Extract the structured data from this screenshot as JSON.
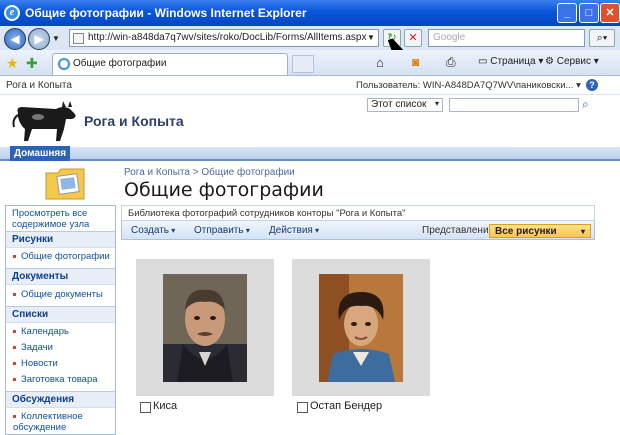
{
  "window": {
    "title": "Общие фотографии - Windows Internet Explorer",
    "minimize_glyph": "_",
    "maximize_glyph": "□",
    "close_glyph": "✕"
  },
  "addressbar": {
    "url": "http://win-a848da7q7wv/sites/roko/DocLib/Forms/AllItems.aspx",
    "search_placeholder": "Google",
    "back_glyph": "◀",
    "forward_glyph": "▶"
  },
  "browser_tab": {
    "label": "Общие фотографии"
  },
  "browser_toolbar": {
    "page_label": "Страница",
    "tools_label": "Сервис"
  },
  "sharepoint": {
    "site_link": "Рога и Копыта",
    "user_label": "Пользователь: WIN-A848DA7Q7WV\\паниковски...",
    "help_glyph": "?",
    "scope_selector": "Этот список",
    "site_title": "Рога и Копыта",
    "home_tab": "Домашняя",
    "breadcrumb": "Рога и Копыта > Общие фотографии",
    "page_title": "Общие фотографии"
  },
  "leftnav": {
    "view_all": "Просмотреть все содержимое узла",
    "sections": [
      {
        "title": "Рисунки",
        "items": [
          "Общие фотографии"
        ]
      },
      {
        "title": "Документы",
        "items": [
          "Общие документы"
        ]
      },
      {
        "title": "Списки",
        "items": [
          "Календарь",
          "Задачи",
          "Новости",
          "Заготовка товара"
        ]
      },
      {
        "title": "Обсуждения",
        "items": [
          "Коллективное обсуждение"
        ]
      }
    ]
  },
  "library": {
    "description": "Библиотека фотографий сотрудников конторы \"Рога и Копыта\"",
    "menus": [
      "Создать",
      "Отправить",
      "Действия"
    ],
    "view_label": "Представление:",
    "view_value": "Все рисунки",
    "pictures": [
      {
        "caption": "Киса"
      },
      {
        "caption": "Остап Бендер"
      }
    ]
  },
  "colors": {
    "accent": "#2d63b4",
    "link": "#10509e",
    "view_highlight": "#f7c74f"
  }
}
